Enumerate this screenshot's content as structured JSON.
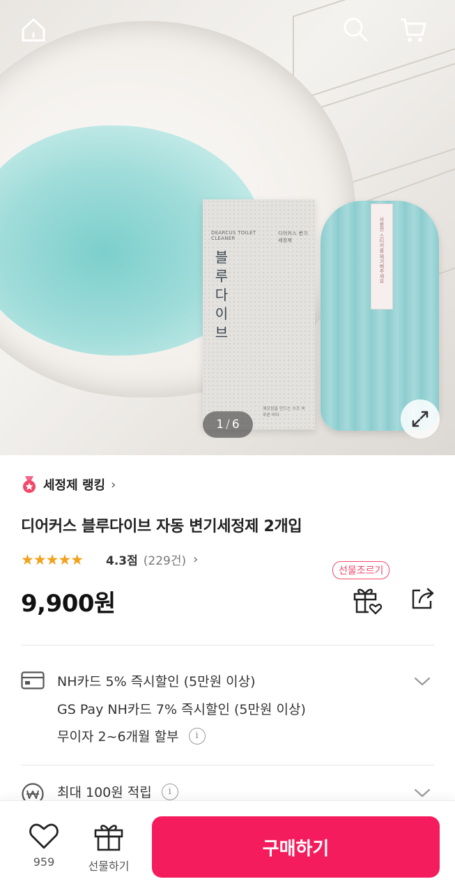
{
  "header": {
    "icons": [
      "home-icon",
      "search-icon",
      "cart-icon"
    ]
  },
  "gallery": {
    "current": "1",
    "separator": "/",
    "total": "6",
    "box_brand": "블루다이브",
    "box_en": "DEARCUS TOILET CLEANER",
    "box_kr": "디어커스 변기 세정제",
    "box_bottom": "깨끗함을 만드는 수조 속 푸른 바다",
    "bottle_sticker": "사용전 스티커를 제거해주세요"
  },
  "product": {
    "ranking_label": "세정제 랭킹",
    "title": "디어커스 블루다이브 자동 변기세정제 2개입",
    "rating": 4.3,
    "rating_score": "4.3점",
    "review_count": "(229건)",
    "gift_tag": "선물조르기",
    "price": "9,900원"
  },
  "benefits": {
    "card_line1": "NH카드 5% 즉시할인 (5만원 이상)",
    "card_line2": "GS Pay NH카드 7% 즉시할인 (5만원 이상)",
    "installment": "무이자 2~6개월 할부",
    "points": "최대 100원 적립"
  },
  "bottom_bar": {
    "like_count": "959",
    "gift_label": "선물하기",
    "buy_label": "구매하기"
  },
  "colors": {
    "accent": "#f41c5c",
    "star": "#f3a21b"
  }
}
